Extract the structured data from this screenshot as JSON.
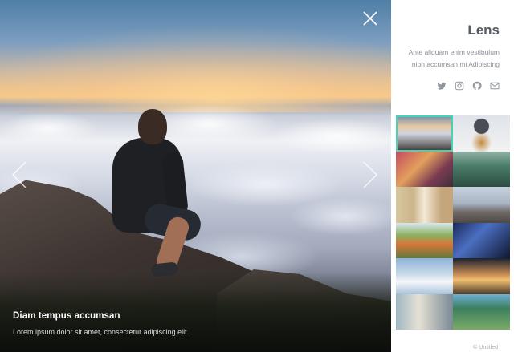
{
  "viewer": {
    "caption_title": "Diam tempus accumsan",
    "caption_text": "Lorem ipsum dolor sit amet, consectetur adipiscing elit.",
    "prev_icon": "chevron-left-icon",
    "next_icon": "chevron-right-icon",
    "close_icon": "close-icon"
  },
  "panel": {
    "brand": "Lens",
    "tagline": "Ante aliquam enim vestibulum nibh accumsan mi Adipiscing",
    "socials": [
      {
        "icon": "twitter-icon"
      },
      {
        "icon": "instagram-icon"
      },
      {
        "icon": "github-icon"
      },
      {
        "icon": "envelope-icon"
      }
    ],
    "active_thumb_index": 0,
    "accent_color": "#46d3b5",
    "footer": "© Untitled"
  }
}
